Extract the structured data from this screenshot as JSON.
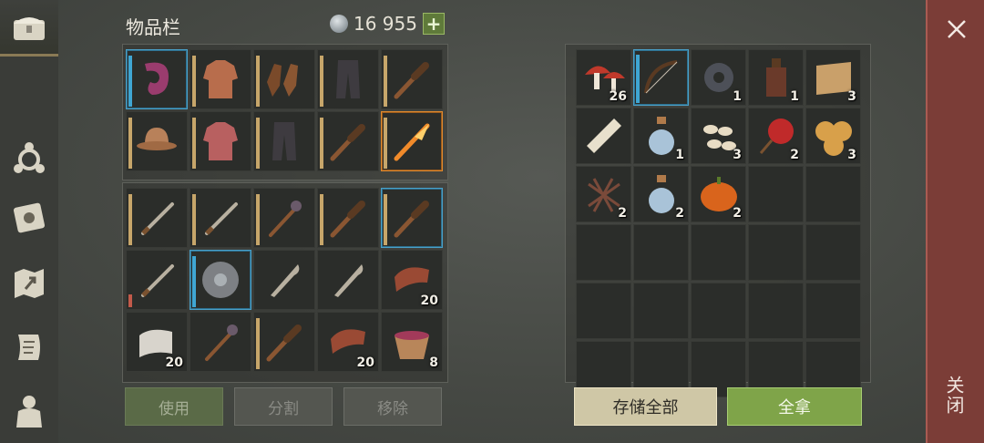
{
  "inventory": {
    "title": "物品栏",
    "currency_value": "16 955",
    "plus_label": "+",
    "equipment": [
      {
        "icon": "scarf-icon",
        "highlight": "blue",
        "dur": "blue",
        "qty": ""
      },
      {
        "icon": "leather-armor-icon",
        "highlight": "",
        "dur": "tan",
        "qty": ""
      },
      {
        "icon": "gloves-icon",
        "highlight": "",
        "dur": "tan",
        "qty": ""
      },
      {
        "icon": "pants-icon",
        "highlight": "",
        "dur": "tan",
        "qty": ""
      },
      {
        "icon": "club-icon",
        "highlight": "",
        "dur": "tan",
        "qty": ""
      },
      {
        "icon": "helmet-icon",
        "highlight": "",
        "dur": "tan",
        "qty": ""
      },
      {
        "icon": "chainmail-icon",
        "highlight": "",
        "dur": "tan",
        "qty": ""
      },
      {
        "icon": "pants-icon",
        "highlight": "",
        "dur": "tan",
        "qty": ""
      },
      {
        "icon": "club-icon",
        "highlight": "",
        "dur": "tan",
        "qty": ""
      },
      {
        "icon": "fire-spear-icon",
        "highlight": "orange",
        "dur": "tan",
        "qty": ""
      }
    ],
    "items": [
      {
        "icon": "sword-icon",
        "highlight": "",
        "dur": "tan",
        "qty": ""
      },
      {
        "icon": "sword-icon",
        "highlight": "",
        "dur": "tan",
        "qty": ""
      },
      {
        "icon": "mace-icon",
        "highlight": "",
        "dur": "tan",
        "qty": ""
      },
      {
        "icon": "club-icon",
        "highlight": "",
        "dur": "tan",
        "qty": ""
      },
      {
        "icon": "club-icon",
        "highlight": "blue",
        "dur": "tan",
        "qty": ""
      },
      {
        "icon": "sword-icon",
        "highlight": "",
        "dur": "red",
        "qty": ""
      },
      {
        "icon": "shield-icon",
        "highlight": "blue",
        "dur": "blue",
        "qty": ""
      },
      {
        "icon": "machete-icon",
        "highlight": "",
        "dur": "",
        "qty": ""
      },
      {
        "icon": "machete-icon",
        "highlight": "",
        "dur": "",
        "qty": ""
      },
      {
        "icon": "meat-icon",
        "highlight": "",
        "dur": "",
        "qty": "20"
      },
      {
        "icon": "cloth-roll-icon",
        "highlight": "",
        "dur": "",
        "qty": "20"
      },
      {
        "icon": "mace-icon",
        "highlight": "",
        "dur": "",
        "qty": ""
      },
      {
        "icon": "club-icon",
        "highlight": "",
        "dur": "tan",
        "qty": ""
      },
      {
        "icon": "meat-icon",
        "highlight": "",
        "dur": "",
        "qty": "20"
      },
      {
        "icon": "berry-bowl-icon",
        "highlight": "",
        "dur": "",
        "qty": "8"
      }
    ],
    "use_label": "使用",
    "split_label": "分割",
    "remove_label": "移除"
  },
  "container": {
    "items": [
      {
        "icon": "mushroom-icon",
        "highlight": "",
        "dur": "",
        "qty": "26"
      },
      {
        "icon": "bow-icon",
        "highlight": "blue",
        "dur": "blue",
        "qty": ""
      },
      {
        "icon": "gear-icon",
        "highlight": "",
        "dur": "",
        "qty": "1"
      },
      {
        "icon": "bottle-icon",
        "highlight": "",
        "dur": "",
        "qty": "1"
      },
      {
        "icon": "rope-icon",
        "highlight": "",
        "dur": "",
        "qty": "3"
      },
      {
        "icon": "scroll-icon",
        "highlight": "",
        "dur": "",
        "qty": ""
      },
      {
        "icon": "potion-icon",
        "highlight": "",
        "dur": "",
        "qty": "1"
      },
      {
        "icon": "seeds-icon",
        "highlight": "",
        "dur": "",
        "qty": "3"
      },
      {
        "icon": "candy-apple-icon",
        "highlight": "",
        "dur": "",
        "qty": "2"
      },
      {
        "icon": "crackers-icon",
        "highlight": "",
        "dur": "",
        "qty": "3"
      },
      {
        "icon": "twine-icon",
        "highlight": "",
        "dur": "",
        "qty": "2"
      },
      {
        "icon": "potion-icon",
        "highlight": "",
        "dur": "",
        "qty": "2"
      },
      {
        "icon": "pumpkin-icon",
        "highlight": "",
        "dur": "",
        "qty": "2"
      },
      {
        "icon": "",
        "highlight": "",
        "dur": "",
        "qty": ""
      },
      {
        "icon": "",
        "highlight": "",
        "dur": "",
        "qty": ""
      }
    ],
    "empty_slots": 15,
    "store_all_label": "存储全部",
    "take_all_label": "全拿"
  },
  "sidebar": [
    {
      "icon": "chest-icon",
      "active": true
    },
    {
      "icon": "crafting-icon",
      "active": false
    },
    {
      "icon": "journal-icon",
      "active": false
    },
    {
      "icon": "map-icon",
      "active": false
    },
    {
      "icon": "quest-scroll-icon",
      "active": false
    },
    {
      "icon": "character-icon",
      "active": false
    }
  ],
  "close_label": "关闭",
  "colors": {
    "accent_green": "#7fa449",
    "highlight_blue": "#4aa0c8",
    "highlight_orange": "#e08a2e",
    "close_red": "#7b3d37"
  }
}
